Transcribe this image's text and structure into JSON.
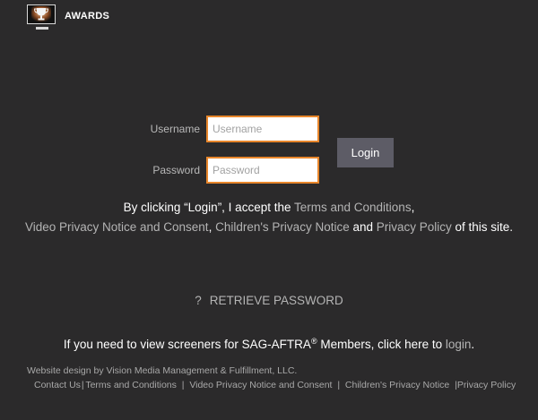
{
  "header": {
    "logo_text": "AWARDS",
    "logo_icon": "trophy-monitor-icon"
  },
  "login_form": {
    "username_label": "Username",
    "username_placeholder": "Username",
    "username_value": "",
    "password_label": "Password",
    "password_placeholder": "Password",
    "password_value": "",
    "login_button": "Login"
  },
  "terms": {
    "prefix": "By clicking “Login”, I accept the ",
    "terms_link": "Terms and Conditions",
    "comma1": ",",
    "video_link": "Video Privacy Notice and Consent",
    "comma2": ", ",
    "children_link": "Children's Privacy Notice",
    "and": " and ",
    "privacy_link": "Privacy Policy",
    "suffix": " of this site."
  },
  "retrieve": {
    "icon_glyph": "?",
    "label": "RETRIEVE PASSWORD"
  },
  "sag": {
    "prefix": "If you need to view screeners for SAG-AFTRA",
    "registered": "®",
    "middle": " Members, click here to ",
    "link": "login",
    "suffix": "."
  },
  "footer": {
    "credit": "Website design by Vision Media Management & Fulfillment, LLC.",
    "links": [
      "Contact Us",
      "Terms and Conditions",
      "Video Privacy Notice and Consent",
      "Children's Privacy Notice",
      "Privacy Policy"
    ],
    "separator": "|"
  },
  "colors": {
    "background": "#2b2a2b",
    "input_border": "#e8862b",
    "button_bg": "#5d5c66",
    "muted_text": "#b4b4b4"
  }
}
